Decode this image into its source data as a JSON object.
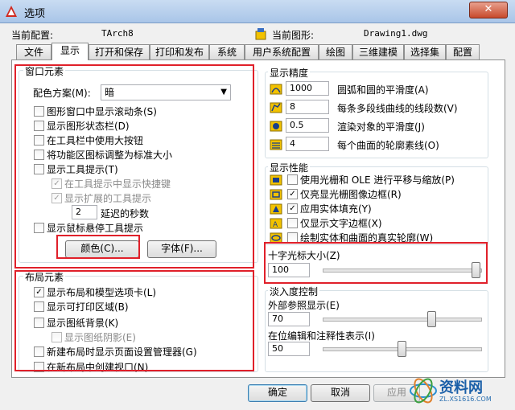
{
  "window": {
    "title": "选项",
    "close_glyph": "✕"
  },
  "profile": {
    "current_config_label": "当前配置:",
    "current_config_value": "TArch8",
    "current_drawing_label": "当前图形:",
    "current_drawing_value": "Drawing1.dwg"
  },
  "tabs": [
    "文件",
    "显示",
    "打开和保存",
    "打印和发布",
    "系统",
    "用户系统配置",
    "绘图",
    "三维建模",
    "选择集",
    "配置"
  ],
  "active_tab": "显示",
  "window_elements": {
    "title": "窗口元素",
    "color_scheme_label": "配色方案(M):",
    "color_scheme_value": "暗",
    "checkboxes": [
      {
        "label": "图形窗口中显示滚动条(S)",
        "checked": false
      },
      {
        "label": "显示图形状态栏(D)",
        "checked": false
      },
      {
        "label": "在工具栏中使用大按钮",
        "checked": false
      },
      {
        "label": "将功能区图标调整为标准大小",
        "checked": false
      },
      {
        "label": "显示工具提示(T)",
        "checked": false
      },
      {
        "label": "在工具提示中显示快捷键",
        "checked": true
      },
      {
        "label": "显示扩展的工具提示",
        "checked": true
      }
    ],
    "delay_value": "2",
    "delay_label": "延迟的秒数",
    "rollover_label": "显示鼠标悬停工具提示",
    "color_button": "颜色(C)...",
    "font_button": "字体(F)..."
  },
  "layout_elements": {
    "title": "布局元素",
    "checkboxes": [
      {
        "label": "显示布局和模型选项卡(L)",
        "checked": true
      },
      {
        "label": "显示可打印区域(B)",
        "checked": false
      },
      {
        "label": "显示图纸背景(K)",
        "checked": false
      },
      {
        "label": "显示图纸阴影(E)",
        "checked": false
      },
      {
        "label": "新建布局时显示页面设置管理器(G)",
        "checked": false
      },
      {
        "label": "在新布局中创建视口(N)",
        "checked": false
      }
    ]
  },
  "display_resolution": {
    "title": "显示精度",
    "rows": [
      {
        "value": "1000",
        "label": "圆弧和圆的平滑度(A)"
      },
      {
        "value": "8",
        "label": "每条多段线曲线的线段数(V)"
      },
      {
        "value": "0.5",
        "label": "渲染对象的平滑度(J)"
      },
      {
        "value": "4",
        "label": "每个曲面的轮廓素线(O)"
      }
    ]
  },
  "display_performance": {
    "title": "显示性能",
    "checkboxes": [
      {
        "label": "使用光栅和 OLE 进行平移与缩放(P)",
        "checked": false
      },
      {
        "label": "仅亮显光栅图像边框(R)",
        "checked": true
      },
      {
        "label": "应用实体填充(Y)",
        "checked": true
      },
      {
        "label": "仅显示文字边框(X)",
        "checked": false
      },
      {
        "label": "绘制实体和曲面的真实轮廓(W)",
        "checked": false
      }
    ]
  },
  "crosshair": {
    "title": "十字光标大小(Z)",
    "value": "100",
    "level_fraction": 1.0
  },
  "fade": {
    "title": "淡入度控制",
    "xref_label": "外部参照显示(E)",
    "xref_value": "70",
    "xref_fraction": 0.7,
    "inplace_label": "在位编辑和注释性表示(I)",
    "inplace_value": "50",
    "inplace_fraction": 0.5
  },
  "footer": {
    "ok": "确定",
    "cancel": "取消",
    "apply": "应用"
  },
  "watermark": {
    "text": "资料网",
    "sub": "ZL.XS1616.COM"
  },
  "colors": {
    "highlight_red": "#e0202a",
    "title_bar": "#b6cfec",
    "icon_yellow": "#f2c200"
  }
}
